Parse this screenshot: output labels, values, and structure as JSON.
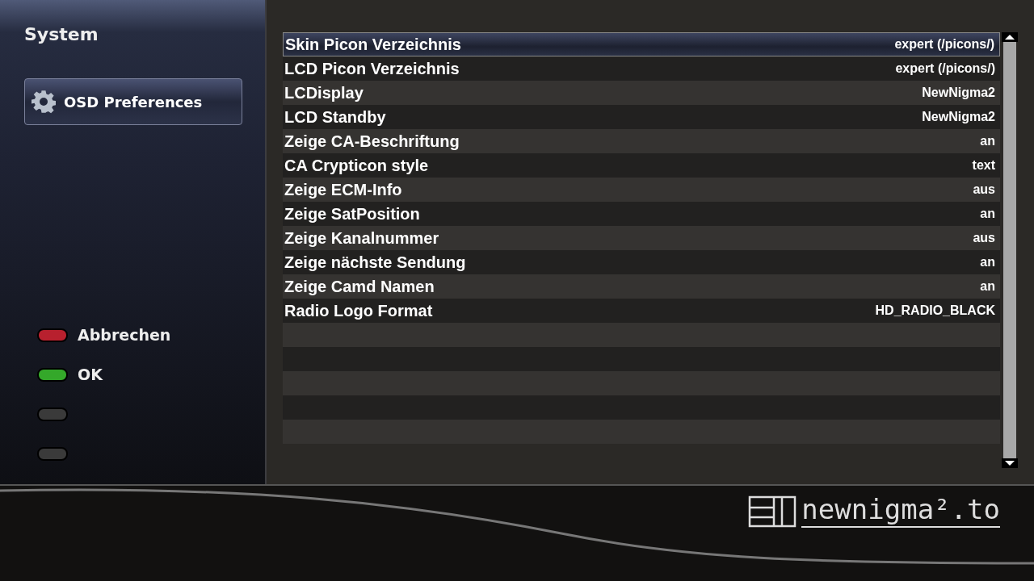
{
  "sidebar": {
    "title": "System",
    "menu_button": {
      "label": "OSD Preferences",
      "selected": true
    },
    "color_buttons": [
      {
        "color": "#b8202e",
        "label": "Abbrechen"
      },
      {
        "color": "#34a82a",
        "label": "OK"
      },
      {
        "color": "#3a3a3a"
      },
      {
        "color": "#3a3a3a"
      }
    ]
  },
  "settings": [
    {
      "name": "Skin Picon Verzeichnis",
      "value": "expert (/picons/)",
      "selected": true
    },
    {
      "name": "LCD Picon Verzeichnis",
      "value": "expert (/picons/)",
      "selected": false
    },
    {
      "name": "LCDisplay",
      "value": "NewNigma2",
      "selected": false
    },
    {
      "name": "LCD Standby",
      "value": "NewNigma2",
      "selected": false
    },
    {
      "name": "Zeige CA-Beschriftung",
      "value": "an",
      "selected": false
    },
    {
      "name": "CA Crypticon style",
      "value": "text",
      "selected": false
    },
    {
      "name": "Zeige ECM-Info",
      "value": "aus",
      "selected": false
    },
    {
      "name": "Zeige SatPosition",
      "value": "an",
      "selected": false
    },
    {
      "name": "Zeige Kanalnummer",
      "value": "aus",
      "selected": false
    },
    {
      "name": "Zeige nächste Sendung",
      "value": "an",
      "selected": false
    },
    {
      "name": "Zeige Camd Namen",
      "value": "an",
      "selected": false
    },
    {
      "name": "Radio Logo Format",
      "value": "HD_RADIO_BLACK",
      "selected": false
    }
  ],
  "footer": {
    "logo_text": "newnigma².to"
  }
}
